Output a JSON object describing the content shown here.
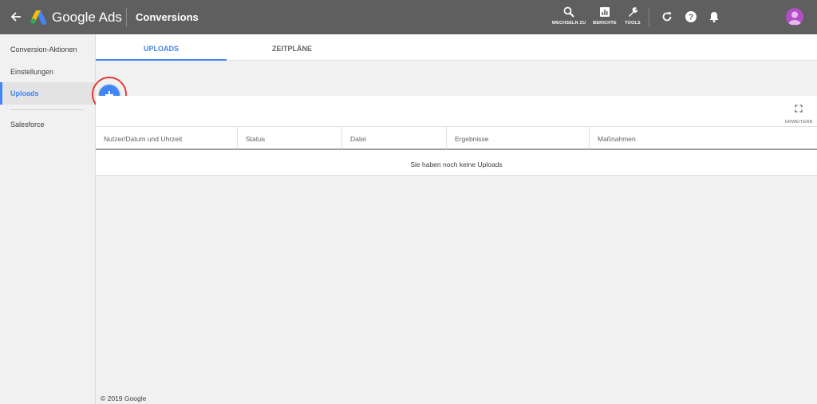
{
  "header": {
    "app_name": "Google Ads",
    "page_title": "Conversions",
    "tools": [
      {
        "label": "WECHSELN ZU",
        "icon": "search-icon"
      },
      {
        "label": "BERICHTE",
        "icon": "reports-icon"
      },
      {
        "label": "TOOLS",
        "icon": "wrench-icon"
      }
    ],
    "actions": [
      "refresh-icon",
      "help-icon",
      "notifications-icon"
    ],
    "colors": {
      "bar": "#5f5f5f",
      "avatar": "#b24fc8"
    }
  },
  "sidebar": {
    "items": [
      {
        "label": "Conversion-Aktionen",
        "active": false
      },
      {
        "label": "Einstellungen",
        "active": false
      },
      {
        "label": "Uploads",
        "active": true
      },
      {
        "label": "Salesforce",
        "active": false
      }
    ]
  },
  "tabs": [
    {
      "label": "UPLOADS",
      "active": true
    },
    {
      "label": "ZEITPLÄNE",
      "active": false
    }
  ],
  "fab": {
    "icon": "plus-icon",
    "highlighted": true,
    "highlight_color": "#e53935"
  },
  "table": {
    "expand_label": "ERWEITERN",
    "columns": [
      "Nutzer/Datum und Uhrzeit",
      "Status",
      "Datei",
      "Ergebnisse",
      "Maßnahmen"
    ],
    "empty_message": "Sie haben noch keine Uploads"
  },
  "footer": {
    "copyright": "© 2019 Google"
  },
  "accent_color": "#4285f4"
}
